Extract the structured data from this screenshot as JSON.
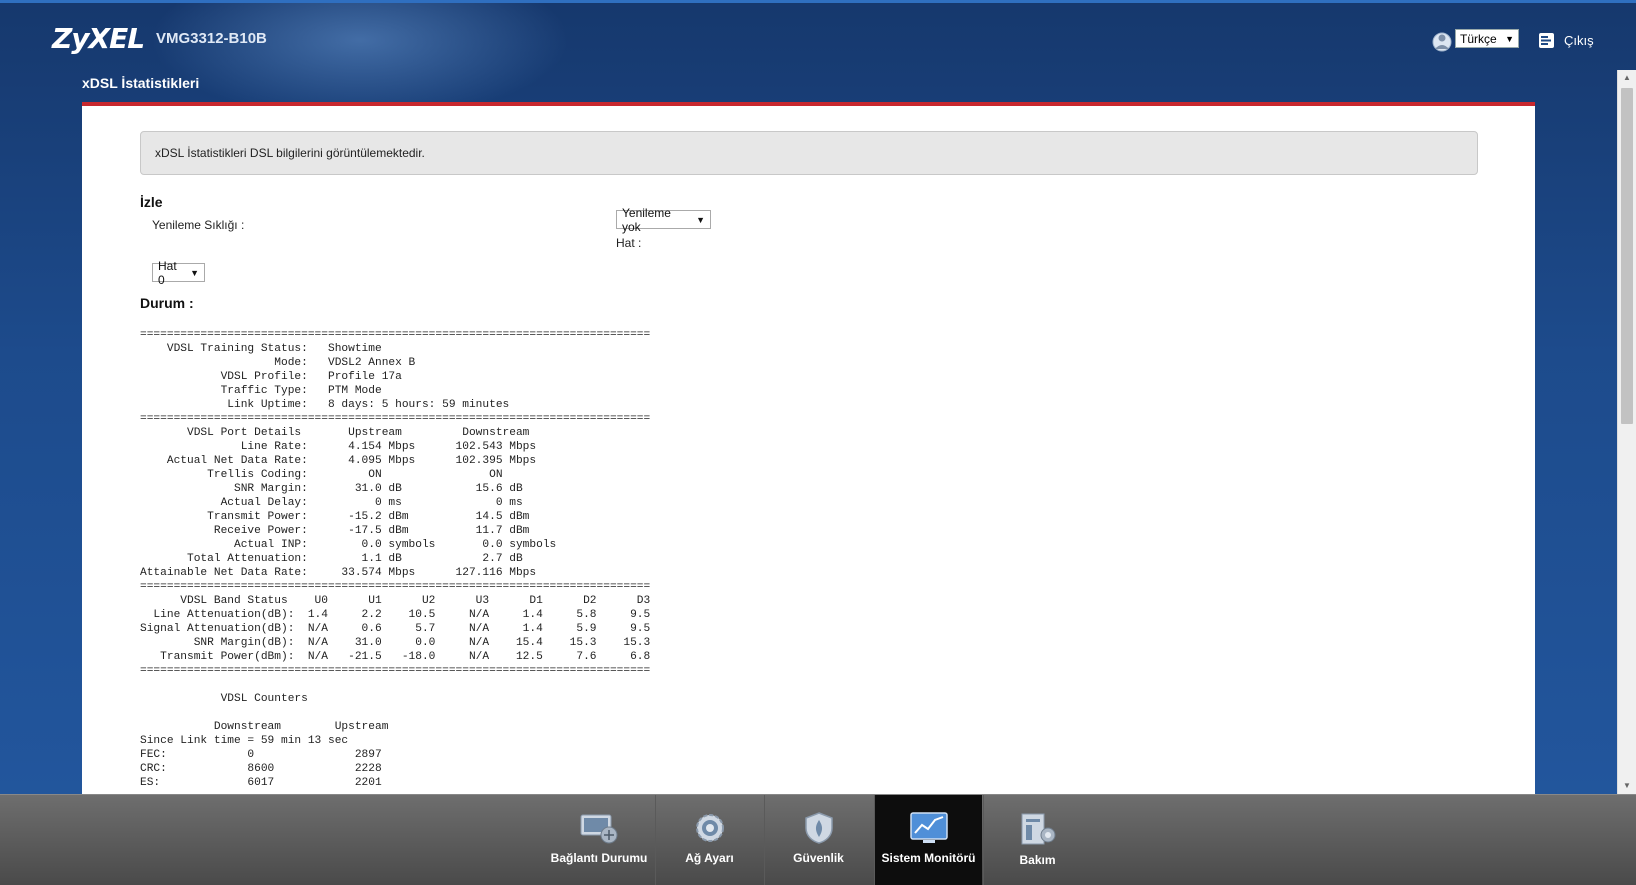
{
  "header": {
    "brand": "ZyXEL",
    "model": "VMG3312-B10B",
    "language": "Türkçe",
    "logout_label": "Çıkış"
  },
  "page": {
    "title": "xDSL İstatistikleri",
    "info_text": "xDSL İstatistikleri DSL bilgilerini görüntülemektedir."
  },
  "monitor": {
    "section_title": "İzle",
    "refresh_label": "Yenileme Sıklığı :",
    "refresh_value": "Yenileme yok",
    "line_label": "Hat :",
    "line_value": "Hat 0"
  },
  "status": {
    "section_title": "Durum :",
    "text": "============================================================================\n    VDSL Training Status:   Showtime\n                    Mode:   VDSL2 Annex B\n            VDSL Profile:   Profile 17a\n            Traffic Type:   PTM Mode\n             Link Uptime:   8 days: 5 hours: 59 minutes\n============================================================================\n       VDSL Port Details       Upstream         Downstream\n               Line Rate:      4.154 Mbps      102.543 Mbps\n    Actual Net Data Rate:      4.095 Mbps      102.395 Mbps\n          Trellis Coding:         ON                ON\n              SNR Margin:       31.0 dB           15.6 dB\n            Actual Delay:          0 ms              0 ms\n          Transmit Power:      -15.2 dBm          14.5 dBm\n           Receive Power:      -17.5 dBm          11.7 dBm\n              Actual INP:        0.0 symbols       0.0 symbols\n       Total Attenuation:        1.1 dB            2.7 dB\nAttainable Net Data Rate:     33.574 Mbps      127.116 Mbps\n============================================================================\n      VDSL Band Status    U0      U1      U2      U3      D1      D2      D3\n  Line Attenuation(dB):  1.4     2.2    10.5     N/A     1.4     5.8     9.5\nSignal Attenuation(dB):  N/A     0.6     5.7     N/A     1.4     5.9     9.5\n        SNR Margin(dB):  N/A    31.0     0.0     N/A    15.4    15.3    15.3\n   Transmit Power(dBm):  N/A   -21.5   -18.0     N/A    12.5     7.6     6.8\n============================================================================\n\n            VDSL Counters\n\n           Downstream        Upstream\nSince Link time = 59 min 13 sec\nFEC:            0               2897\nCRC:            8600            2228\nES:             6017            2201"
  },
  "nav": {
    "items": [
      {
        "label": "Bağlantı Durumu",
        "icon": "connection-status-icon"
      },
      {
        "label": "Ağ Ayarı",
        "icon": "gear-icon"
      },
      {
        "label": "Güvenlik",
        "icon": "shield-icon"
      },
      {
        "label": "Sistem Monitörü",
        "icon": "chart-monitor-icon"
      },
      {
        "label": "Bakım",
        "icon": "maintenance-icon"
      }
    ],
    "active_index": 3
  },
  "colors": {
    "background": "#1e4a86",
    "accent_red": "#c8282e",
    "footer": "#5a5a5a",
    "active_nav": "#0d0d0d"
  }
}
